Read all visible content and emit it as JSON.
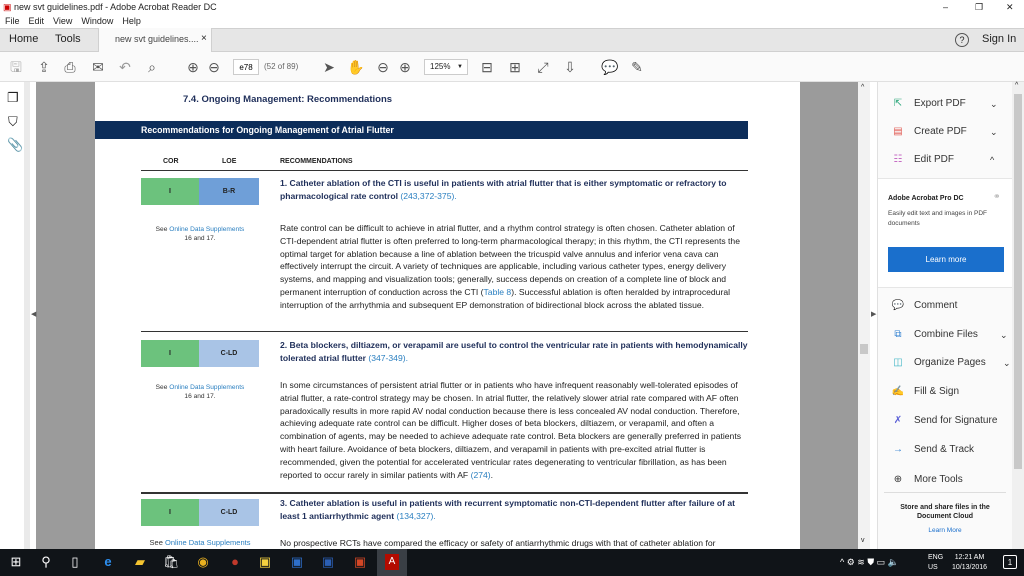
{
  "window": {
    "title": "new svt guidelines.pdf - Adobe Acrobat Reader DC",
    "minimize": "–",
    "restore": "❐",
    "close": "✕"
  },
  "menu": [
    "File",
    "Edit",
    "View",
    "Window",
    "Help"
  ],
  "tabs": {
    "home": "Home",
    "tools": "Tools",
    "document": "new svt guidelines....",
    "close": "×",
    "help": "?",
    "sign_in": "Sign In"
  },
  "toolbar": {
    "page_input": "e78",
    "page_count": "(52 of 89)",
    "zoom": "125%",
    "icons": [
      "save-icon",
      "upload-icon",
      "print-icon",
      "email-icon",
      "undo-icon",
      "search-icon",
      "page-up-icon",
      "page-down-icon",
      "select-arrow-icon",
      "hand-icon",
      "zoom-out-icon",
      "zoom-in-icon",
      "fit-page-icon",
      "scroll-mode-icon",
      "fullscreen-icon",
      "read-mode-icon",
      "comment-icon",
      "highlight-pen-icon"
    ]
  },
  "document": {
    "section_heading": "7.4. Ongoing Management: Recommendations",
    "table_title": "Recommendations for Ongoing Management of Atrial Flutter",
    "headers": {
      "cor": "COR",
      "loe": "LOE",
      "recommendations": "RECOMMENDATIONS"
    },
    "rows": [
      {
        "cor": "I",
        "loe": "B-R",
        "loe_color": "#6f9fd8",
        "rec": "1. Catheter ablation of the CTI is useful in patients with atrial flutter that is either symptomatic or refractory to pharmacological rate control ",
        "ref": "(243,372-375).",
        "see_prefix": "See ",
        "see_link": "Online Data Supplements",
        "see_suffix": "16 and 17.",
        "text_a": "Rate control can be difficult to achieve in atrial flutter, and a rhythm control strategy is often chosen. Catheter ablation of CTI-dependent atrial flutter is often preferred to long-term pharmacological therapy; in this rhythm, the CTI represents the optimal target for ablation because a line of ablation between the tricuspid valve annulus and inferior vena cava can effectively interrupt the circuit. A variety of techniques are applicable, including various catheter types, energy delivery systems, and mapping and visualization tools; generally, success depends on creation of a complete line of block and permanent interruption of conduction across the CTI (",
        "text_link": "Table 8",
        "text_b": "). Successful ablation is often heralded by intraprocedural interruption of the arrhythmia and subsequent EP demonstration of bidirectional block across the ablated tissue."
      },
      {
        "cor": "I",
        "loe": "C-LD",
        "loe_color": "#a9c4e6",
        "rec": "2. Beta blockers, diltiazem, or verapamil are useful to control the ventricular rate in patients with hemodynamically tolerated atrial flutter ",
        "ref": "(347-349).",
        "see_prefix": "See ",
        "see_link": "Online Data Supplements",
        "see_suffix": "16 and 17.",
        "text_a": "In some circumstances of persistent atrial flutter or in patients who have infrequent reasonably well-tolerated episodes of atrial flutter, a rate-control strategy may be chosen. In atrial flutter, the relatively slower atrial rate compared with AF often paradoxically results in more rapid AV nodal conduction because there is less concealed AV nodal conduction. Therefore, achieving adequate rate control can be difficult. Higher doses of beta blockers, diltiazem, or verapamil, and often a combination of agents, may be needed to achieve adequate rate control. Beta blockers are generally preferred in patients with heart failure. Avoidance of beta blockers, diltiazem, and verapamil in patients with pre-excited atrial flutter is recommended, given the potential for accelerated ventricular rates degenerating to ventricular fibrillation, as has been reported to occur rarely in similar patients with AF ",
        "text_link": "(274)",
        "text_b": "."
      },
      {
        "cor": "I",
        "loe": "C-LD",
        "loe_color": "#a9c4e6",
        "rec": "3. Catheter ablation is useful in patients with recurrent symptomatic non-CTI-dependent flutter after failure of at least 1 antiarrhythmic agent ",
        "ref": "(134,327).",
        "see_prefix": "See ",
        "see_link": "Online Data Supplements",
        "see_suffix": "",
        "text_a": "No prospective RCTs have compared the efficacy or safety of antiarrhythmic drugs with that of catheter ablation for",
        "text_link": "",
        "text_b": ""
      }
    ]
  },
  "right_panel": {
    "tools": [
      {
        "label": "Export PDF",
        "icon": "export-pdf-icon",
        "chev": "⌄"
      },
      {
        "label": "Create PDF",
        "icon": "create-pdf-icon",
        "chev": "⌄"
      },
      {
        "label": "Edit PDF",
        "icon": "edit-pdf-icon",
        "chev": "^"
      }
    ],
    "promo": {
      "title": "Adobe Acrobat Pro DC",
      "desc": "Easily edit text and images in PDF documents",
      "button": "Learn more"
    },
    "tools2": [
      {
        "label": "Comment",
        "icon": "comment-icon",
        "chev": ""
      },
      {
        "label": "Combine Files",
        "icon": "combine-files-icon",
        "chev": "⌄"
      },
      {
        "label": "Organize Pages",
        "icon": "organize-pages-icon",
        "chev": "⌄"
      },
      {
        "label": "Fill & Sign",
        "icon": "fill-sign-icon",
        "chev": ""
      },
      {
        "label": "Send for Signature",
        "icon": "send-signature-icon",
        "chev": ""
      },
      {
        "label": "Send & Track",
        "icon": "send-track-icon",
        "chev": ""
      },
      {
        "label": "More Tools",
        "icon": "more-tools-icon",
        "chev": ""
      }
    ],
    "cloud_text": "Store and share files in the Document Cloud",
    "cloud_link": "Learn More"
  },
  "taskbar": {
    "lang1": "ENG",
    "lang2": "US",
    "time": "12:21 AM",
    "date": "10/13/2016",
    "notifications": "1"
  },
  "colors": {
    "navy": "#0c2d5a",
    "cor_green": "#6cc27d",
    "link": "#2a7fc0",
    "learn_more": "#1a6fcc"
  }
}
